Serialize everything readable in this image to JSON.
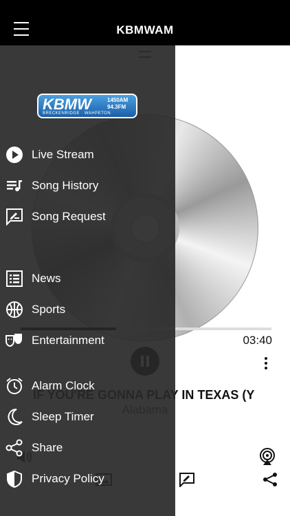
{
  "header": {
    "title": "KBMWAM"
  },
  "logo": {
    "main": "KBMW",
    "am": "1450AM",
    "fm": "94.3FM",
    "tagline": "BRECKENRIDGE · WAHPETON"
  },
  "menu": {
    "items": [
      {
        "label": "Live Stream",
        "icon": "play-circle-icon"
      },
      {
        "label": "Song History",
        "icon": "queue-music-icon"
      },
      {
        "label": "Song Request",
        "icon": "rate-review-icon"
      },
      {
        "label": "News",
        "icon": "list-alt-icon"
      },
      {
        "label": "Sports",
        "icon": "basketball-icon"
      },
      {
        "label": "Entertainment",
        "icon": "theater-masks-icon"
      },
      {
        "label": "Alarm Clock",
        "icon": "alarm-icon"
      },
      {
        "label": "Sleep Timer",
        "icon": "moon-icon"
      },
      {
        "label": "Share",
        "icon": "share-icon"
      },
      {
        "label": "Privacy Policy",
        "icon": "shield-icon"
      }
    ]
  },
  "player": {
    "progress": 0.38,
    "total_time": "03:40",
    "song_title": "IF YOU'RE GONNA PLAY IN TEXAS (Y",
    "artist": "Alabama"
  }
}
